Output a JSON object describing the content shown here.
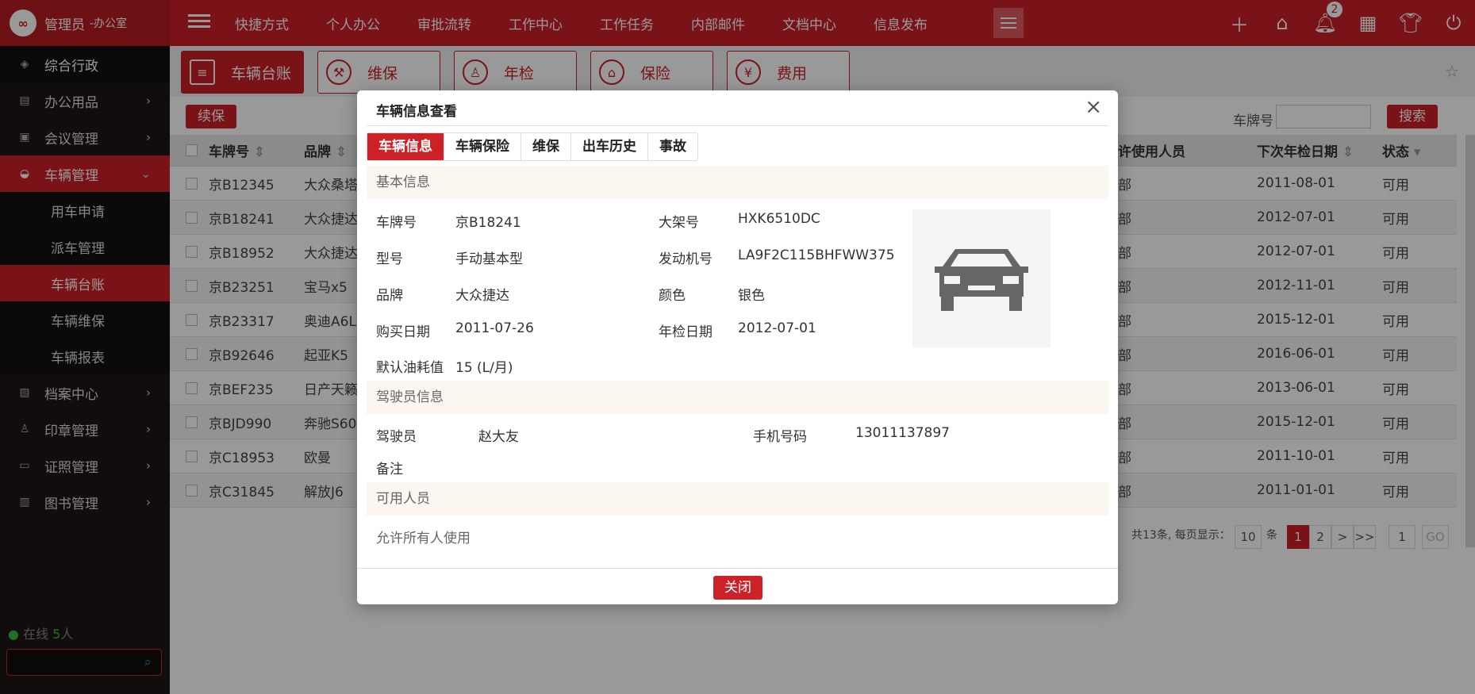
{
  "brand": {
    "user": "管理员",
    "dept": "-办公室",
    "logo": "∞"
  },
  "nav": [
    "快捷方式",
    "个人办公",
    "审批流转",
    "工作中心",
    "工作任务",
    "内部邮件",
    "文档中心",
    "信息发布"
  ],
  "notifications": {
    "count": "2"
  },
  "sidebar": {
    "top": "综合行政",
    "items": [
      {
        "label": "办公用品",
        "icon": "printer-icon"
      },
      {
        "label": "会议管理",
        "icon": "meeting-icon"
      },
      {
        "label": "车辆管理",
        "icon": "car-icon"
      }
    ],
    "sub": [
      "用车申请",
      "派车管理",
      "车辆台账",
      "车辆维保",
      "车辆报表"
    ],
    "items2": [
      {
        "label": "档案中心",
        "icon": "archive-icon"
      },
      {
        "label": "印章管理",
        "icon": "seal-icon"
      },
      {
        "label": "证照管理",
        "icon": "license-icon"
      },
      {
        "label": "图书管理",
        "icon": "book-icon"
      }
    ],
    "online_label": "在线",
    "online_count": "5",
    "online_unit": "人"
  },
  "page_tabs": [
    "车辆台账",
    "维保",
    "年检",
    "保险",
    "费用"
  ],
  "toolbar": {
    "renew": "续保",
    "plate_label": "车牌号",
    "search": "搜索"
  },
  "table": {
    "headers": {
      "plate": "车牌号",
      "brand": "品牌",
      "user": "许使用人员",
      "date": "下次年检日期",
      "status": "状态"
    },
    "rows": [
      {
        "plate": "京B12345",
        "brand": "大众桑塔",
        "user": "部",
        "date": "2011-08-01",
        "status": "可用"
      },
      {
        "plate": "京B18241",
        "brand": "大众捷达",
        "user": "部",
        "date": "2012-07-01",
        "status": "可用"
      },
      {
        "plate": "京B18952",
        "brand": "大众捷达",
        "user": "部",
        "date": "2012-07-01",
        "status": "可用"
      },
      {
        "plate": "京B23251",
        "brand": "宝马x5",
        "user": "部",
        "date": "2012-11-01",
        "status": "可用"
      },
      {
        "plate": "京B23317",
        "brand": "奥迪A6L",
        "user": "部",
        "date": "2015-12-01",
        "status": "可用"
      },
      {
        "plate": "京B92646",
        "brand": "起亚K5",
        "user": "部",
        "date": "2016-06-01",
        "status": "可用"
      },
      {
        "plate": "京BEF235",
        "brand": "日产天籁",
        "user": "部",
        "date": "2013-06-01",
        "status": "可用"
      },
      {
        "plate": "京BJD990",
        "brand": "奔驰S600",
        "user": "部",
        "date": "2015-12-01",
        "status": "可用"
      },
      {
        "plate": "京C18953",
        "brand": "欧曼",
        "user": "部",
        "date": "2011-10-01",
        "status": "可用"
      },
      {
        "plate": "京C31845",
        "brand": "解放J6",
        "user": "部",
        "date": "2011-01-01",
        "status": "可用"
      }
    ]
  },
  "pager": {
    "summary": "共13条, 每页显示：",
    "per_page": "10",
    "unit": "条",
    "p1": "1",
    "p2": "2",
    "next": ">",
    "last": ">>",
    "goto": "1",
    "go": "GO"
  },
  "modal": {
    "title": "车辆信息查看",
    "tabs": [
      "车辆信息",
      "车辆保险",
      "维保",
      "出车历史",
      "事故"
    ],
    "sec_basic": "基本信息",
    "fields": {
      "plate_l": "车牌号",
      "plate_v": "京B18241",
      "frame_l": "大架号",
      "frame_v": "HXK6510DC",
      "model_l": "型号",
      "model_v": "手动基本型",
      "engine_l": "发动机号",
      "engine_v": "LA9F2C115BHFWW375",
      "brand_l": "品牌",
      "brand_v": "大众捷达",
      "color_l": "颜色",
      "color_v": "银色",
      "buy_l": "购买日期",
      "buy_v": "2011-07-26",
      "insp_l": "年检日期",
      "insp_v": "2012-07-01",
      "fuel_l": "默认油耗值",
      "fuel_v": "15 (L/月)"
    },
    "sec_driver": "驾驶员信息",
    "driver": {
      "driver_l": "驾驶员",
      "driver_v": "赵大友",
      "phone_l": "手机号码",
      "phone_v": "13011137897",
      "note_l": "备注"
    },
    "sec_users": "可用人员",
    "users_text": "允许所有人使用",
    "close": "关闭"
  }
}
